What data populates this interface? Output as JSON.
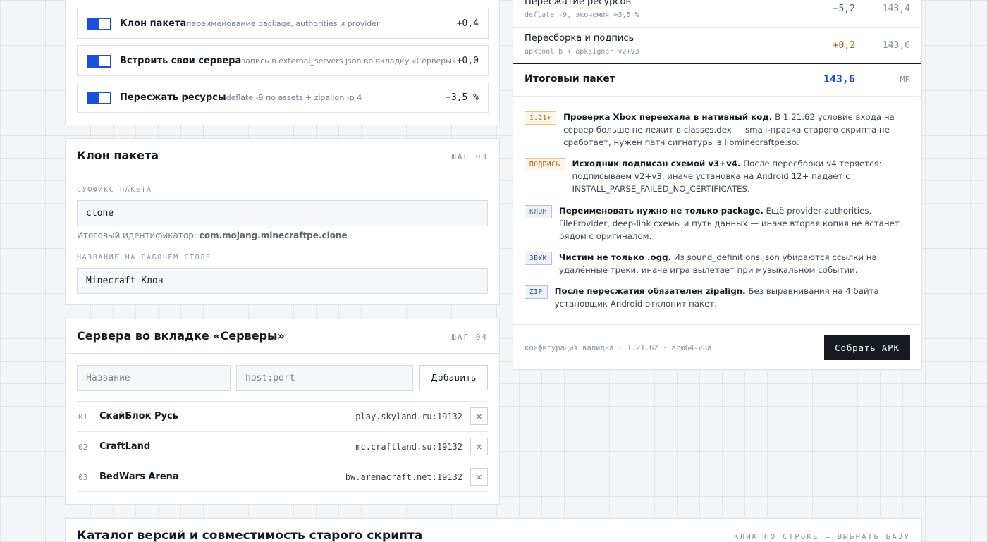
{
  "toggles": [
    {
      "title": "Клон пакета",
      "desc": "переименование package, authorities и provider",
      "value": "+0,4"
    },
    {
      "title": "Встроить свои сервера",
      "desc": "запись в external_servers.json во вкладку «Серверы»",
      "value": "+0,0"
    },
    {
      "title": "Пересжать ресурсы",
      "desc": "deflate -9 по assets + zipalign -p 4",
      "value": "−3,5 %"
    }
  ],
  "clone": {
    "title": "Клон пакета",
    "step": "ШАГ 03",
    "suffix_label": "СУФФИКС ПАКЕТА",
    "suffix_value": "clone",
    "id_hint_prefix": "Итоговый идентификатор:",
    "id_hint_value": "com.mojang.minecraftpe.clone",
    "desktop_label": "НАЗВАНИЕ НА РАБОЧЕМ СТОЛЕ",
    "desktop_value": "Minecraft Клон"
  },
  "servers": {
    "title": "Сервера во вкладке «Серверы»",
    "step": "ШАГ 04",
    "name_placeholder": "Название",
    "host_placeholder": "host:port",
    "add_label": "Добавить",
    "delete_label": "×",
    "items": [
      {
        "num": "01",
        "name": "СкайБлок Русь",
        "host": "play.skyland.ru:19132"
      },
      {
        "num": "02",
        "name": "CraftLand",
        "host": "mc.craftland.su:19132"
      },
      {
        "num": "03",
        "name": "BedWars Arena",
        "host": "bw.arenacraft.net:19132"
      }
    ]
  },
  "catalog": {
    "title": "Каталог версий и совместимость старого скрипта",
    "hint": "КЛИК ПО СТРОКЕ — ВЫБРАТЬ БАЗУ"
  },
  "summary": {
    "rows": [
      {
        "name": "Пересжатие ресурсов",
        "desc": "deflate -9, экономия ≈3,5 %",
        "delta": "−5,2",
        "value": "143,4"
      },
      {
        "name": "Пересборка и подпись",
        "desc": "apktool b + apksigner v2+v3",
        "delta": "+0,2",
        "value": "143,6"
      }
    ],
    "total_label": "Итоговый пакет",
    "total_value": "143,6",
    "total_unit": "МБ",
    "notes": [
      {
        "tag": "1.21+",
        "title": "Проверка Xbox переехала в нативный код.",
        "text": " В 1.21.62 условие входа на сервер больше не лежит в classes.dex — smali-правка старого скрипта не сработает, нужен патч сигнатуры в libminecraftpe.so."
      },
      {
        "tag": "ПОДПИСЬ",
        "title": "Исходник подписан схемой v3+v4.",
        "text": " После пересборки v4 теряется: подписываем v2+v3, иначе установка на Android 12+ падает с INSTALL_PARSE_FAILED_NO_CERTIFICATES."
      },
      {
        "tag": "КЛОН",
        "title": "Переименовать нужно не только package.",
        "text": " Ещё provider authorities, FileProvider, deep-link схемы и путь данных — иначе вторая копия не встанет рядом с оригиналом."
      },
      {
        "tag": "ЗВУК",
        "title": "Чистим не только .ogg.",
        "text": " Из sound_definitions.json убираются ссылки на удалённые треки, иначе игра вылетает при музыкальном событии."
      },
      {
        "tag": "ZIP",
        "title": "После пересжатия обязателен zipalign.",
        "text": " Без выравнивания на 4 байта установщик Android отклонит пакет."
      }
    ],
    "status": "конфигурация валидна · 1.21.62 · arm64-v8a",
    "build_label": "Собрать APK"
  },
  "colors": {
    "accent": "#1a4fd6",
    "negative_delta": "#1f6b4a",
    "positive_delta": "#b35a10",
    "dark": "#161b22"
  }
}
